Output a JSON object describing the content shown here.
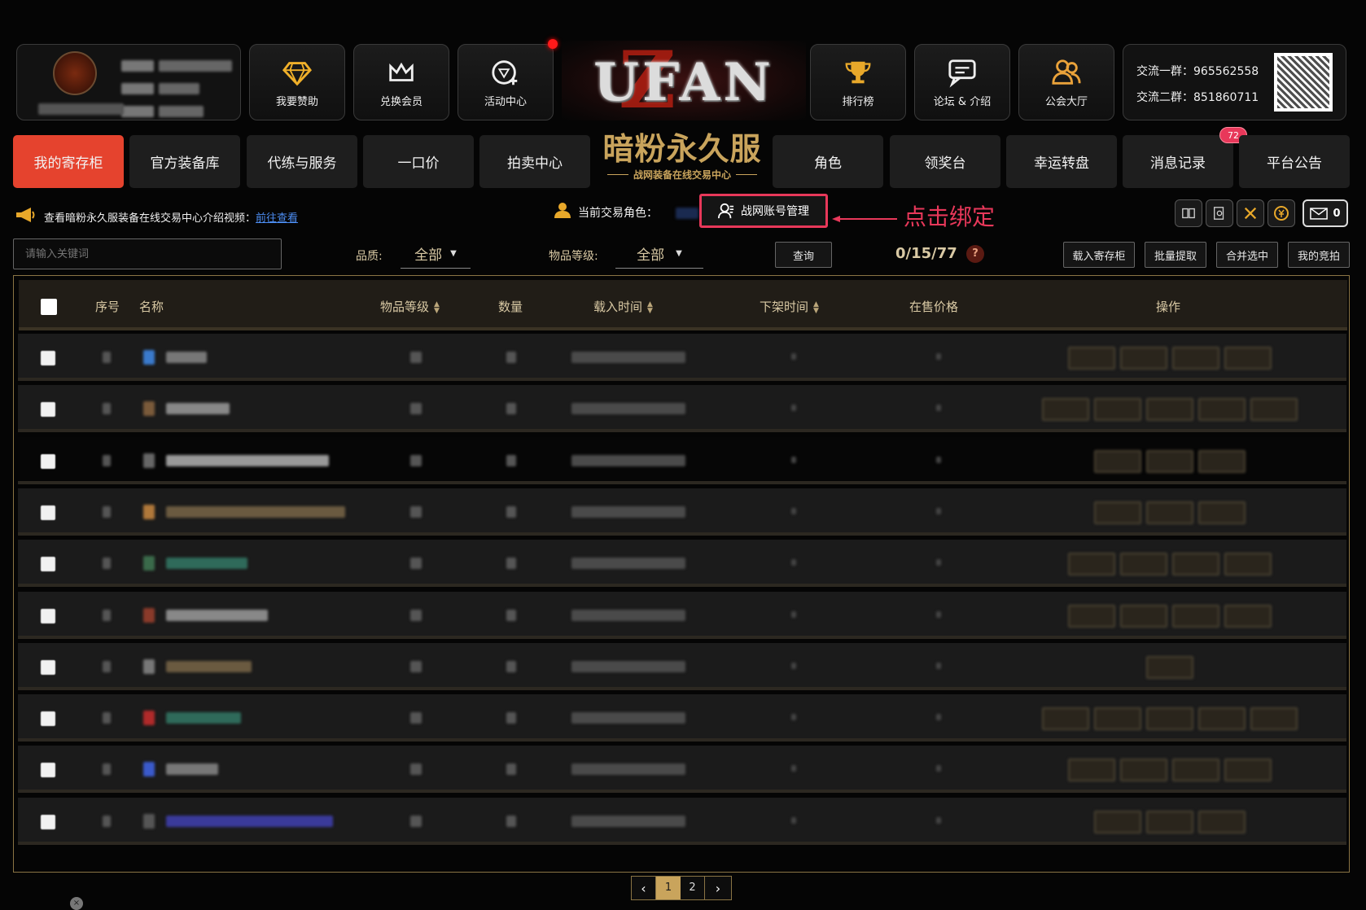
{
  "header": {
    "tiles": [
      {
        "label": "我要赞助",
        "icon": "diamond-icon"
      },
      {
        "label": "兑换会员",
        "icon": "crown-icon"
      },
      {
        "label": "活动中心",
        "icon": "gem-plus-icon"
      },
      {
        "label": "排行榜",
        "icon": "trophy-icon"
      },
      {
        "label": "论坛 & 介绍",
        "icon": "chat-icon"
      },
      {
        "label": "公会大厅",
        "icon": "group-icon"
      }
    ],
    "logo_text": "UFAN",
    "qq_group_1": "交流一群：965562558",
    "qq_group_2": "交流二群：851860711"
  },
  "nav": {
    "items": [
      {
        "label": "我的寄存柜",
        "active": true
      },
      {
        "label": "官方装备库"
      },
      {
        "label": "代练与服务"
      },
      {
        "label": "一口价"
      },
      {
        "label": "拍卖中心"
      },
      {
        "label": "角色"
      },
      {
        "label": "领奖台"
      },
      {
        "label": "幸运转盘"
      },
      {
        "label": "消息记录",
        "badge": "72"
      },
      {
        "label": "平台公告"
      }
    ],
    "brand_title": "暗粉永久服",
    "brand_subtitle": "战网装备在线交易中心"
  },
  "notice": {
    "text": "查看暗粉永久服装备在线交易中心介绍视频：",
    "link": "前往查看",
    "role_label": "当前交易角色：",
    "account_button": "战网账号管理",
    "annotation": "点击绑定",
    "mail_count": "0"
  },
  "filters": {
    "search_placeholder": "请输入关键词",
    "quality_label": "品质:",
    "quality_value": "全部",
    "level_label": "物品等级:",
    "level_value": "全部",
    "query_button": "查询",
    "counter": "0/15/77",
    "help": "?",
    "actions": [
      "载入寄存柜",
      "批量提取",
      "合并选中",
      "我的竞拍"
    ]
  },
  "table": {
    "headers": {
      "index": "序号",
      "name": "名称",
      "level": "物品等级",
      "qty": "数量",
      "load_time": "载入时间",
      "off_time": "下架时间",
      "price": "在售价格",
      "ops": "操作"
    }
  },
  "pagination": {
    "pages": [
      "1",
      "2"
    ],
    "current": "1"
  },
  "colors": {
    "accent": "#e5432e",
    "gold": "#c9a45c",
    "highlight": "#e8385a"
  }
}
